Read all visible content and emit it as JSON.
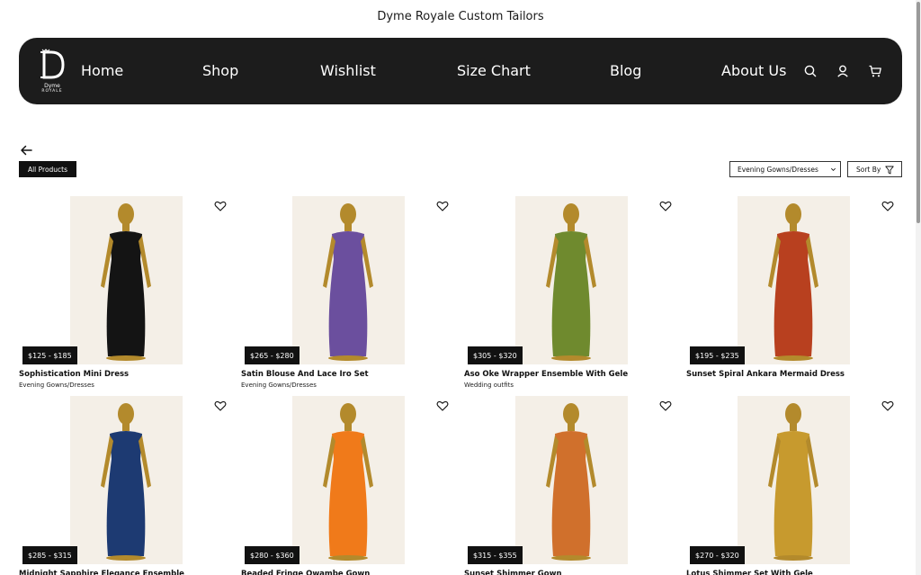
{
  "site": {
    "banner": "Dyme Royale Custom Tailors"
  },
  "logo": {
    "line1": "Dyme",
    "line2": "ROYALE"
  },
  "nav": {
    "items": [
      "Home",
      "Shop",
      "Wishlist",
      "Size Chart",
      "Blog",
      "About Us"
    ],
    "icons": [
      "search-icon",
      "user-icon",
      "cart-icon"
    ]
  },
  "toolbar": {
    "all_products": "All Products",
    "category_selected": "Evening Gowns/Dresses",
    "sort_label": "Sort By"
  },
  "products": [
    {
      "name": "Sophistication Mini Dress",
      "price": "$125 - $185",
      "category": "Evening Gowns/Dresses",
      "dress_color": "#141414"
    },
    {
      "name": "Satin Blouse And Lace Iro Set",
      "price": "$265 - $280",
      "category": "Evening Gowns/Dresses",
      "dress_color": "#6b4f9e"
    },
    {
      "name": "Aso Oke Wrapper Ensemble With Gele",
      "price": "$305 - $320",
      "category": "Wedding outfits",
      "dress_color": "#6f8a2e"
    },
    {
      "name": "Sunset Spiral Ankara Mermaid Dress",
      "price": "$195 - $235",
      "category": "",
      "dress_color": "#b8401f"
    },
    {
      "name": "Midnight Sapphire Elegance Ensemble",
      "price": "$285 - $315",
      "category": "",
      "dress_color": "#1d3a72"
    },
    {
      "name": "Beaded Fringe Owambe Gown",
      "price": "$280 - $360",
      "category": "",
      "dress_color": "#f07a1a"
    },
    {
      "name": "Sunset Shimmer Gown",
      "price": "$315 - $355",
      "category": "",
      "dress_color": "#d0702c"
    },
    {
      "name": "Lotus Shimmer Set With Gele",
      "price": "$270 - $320",
      "category": "",
      "dress_color": "#c79a2e"
    }
  ]
}
